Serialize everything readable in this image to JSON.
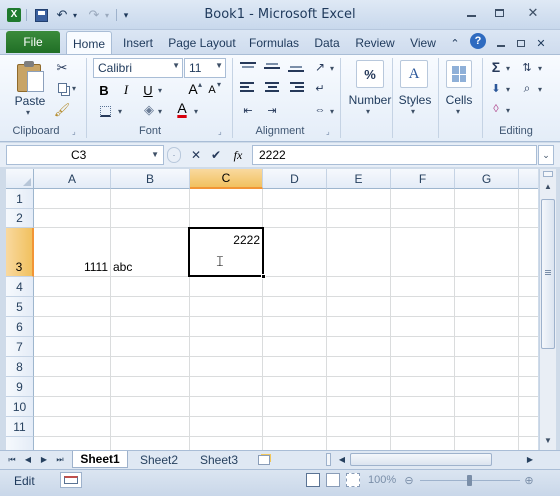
{
  "window": {
    "title": "Book1 - Microsoft Excel"
  },
  "tabs": {
    "file": "File",
    "home": "Home",
    "insert": "Insert",
    "page_layout": "Page Layout",
    "formulas": "Formulas",
    "data": "Data",
    "review": "Review",
    "view": "View"
  },
  "ribbon": {
    "paste_label": "Paste",
    "font_name": "Calibri",
    "font_size": "11",
    "bold": "B",
    "italic": "I",
    "underline": "U",
    "increase_font": "A",
    "decrease_font": "A",
    "font_color": "A",
    "number_symbol": "%",
    "number_label": "Number",
    "styles_symbol": "A",
    "styles_label": "Styles",
    "cells_label": "Cells",
    "sigma": "Σ",
    "groups": {
      "clipboard": "Clipboard",
      "font": "Font",
      "alignment": "Alignment",
      "editing": "Editing"
    }
  },
  "formula_bar": {
    "name_box": "C3",
    "fx_label": "fx",
    "value": "2222"
  },
  "grid": {
    "columns": [
      "A",
      "B",
      "C",
      "D",
      "E",
      "F",
      "G"
    ],
    "rows": [
      "1",
      "2",
      "3",
      "4",
      "5",
      "6",
      "7",
      "8",
      "9",
      "10",
      "11"
    ],
    "selected_cell": "C3",
    "cells": {
      "A3": "1111",
      "B3": "abc",
      "C3": "2222"
    }
  },
  "sheets": {
    "tabs": [
      "Sheet1",
      "Sheet2",
      "Sheet3"
    ],
    "active": "Sheet1"
  },
  "status": {
    "mode": "Edit",
    "zoom": "100%"
  },
  "colors": {
    "file_tab": "#206f26",
    "selection_header": "#f1c15f",
    "font_color_bar": "#d8000c"
  }
}
